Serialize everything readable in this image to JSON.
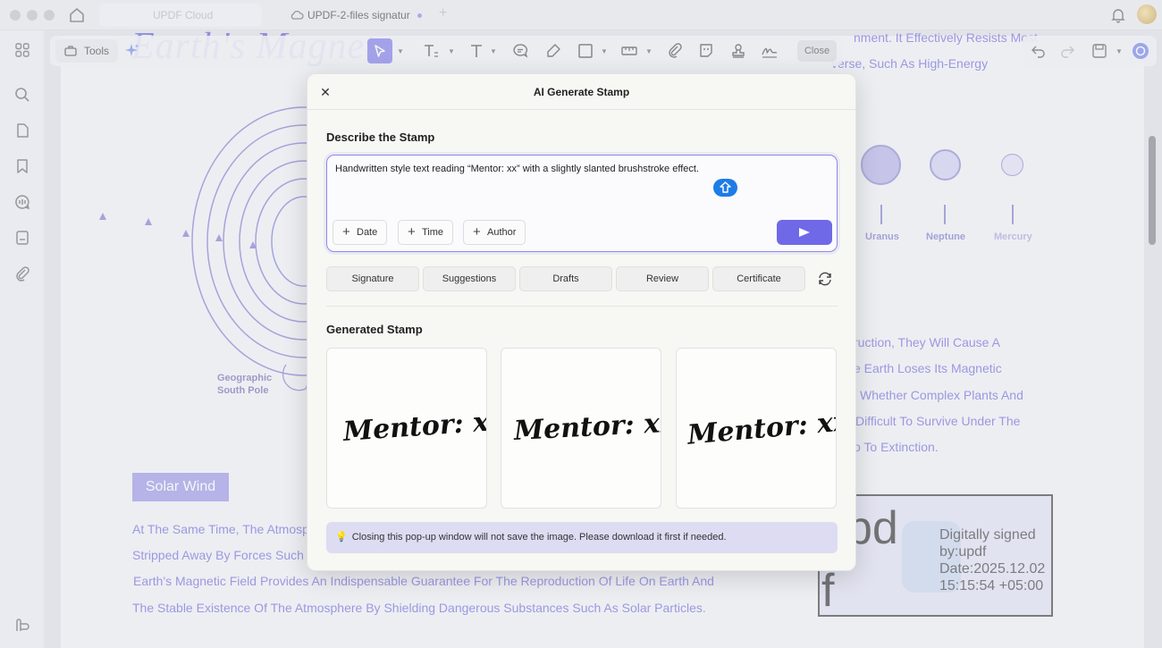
{
  "titlebar": {
    "tabs": [
      {
        "label": "UPDF Cloud"
      },
      {
        "label": "UPDF-2-files signatur"
      }
    ],
    "new_tab_symbol": "+"
  },
  "toolbar": {
    "tools_label": "Tools",
    "close_label": "Close"
  },
  "document": {
    "title": "Earth's Magnet",
    "top_lines": [
      "nment. It Effectively Resists Most",
      "verse, Such As High-Energy"
    ],
    "geo_label_line1": "Geographic",
    "geo_label_line2": "South Pole",
    "planets": [
      {
        "name": "Uranus"
      },
      {
        "name": "Neptune"
      },
      {
        "name": "Mercury"
      }
    ],
    "right_lines": [
      "ruction, They Will Cause A",
      "e Earth Loses Its Magnetic",
      "Whether Complex Plants And",
      "Difficult To Survive Under The",
      "o To Extinction."
    ],
    "solar_wind_label": "Solar Wind",
    "bottom_lines": [
      "At The Same Time, The Atmosp",
      "Stripped Away By Forces Such A",
      "Earth's Magnetic Field Provides An Indispensable Guarantee For The Reproduction Of Life On Earth And",
      "The Stable Existence Of The Atmosphere By Shielding Dangerous Substances Such As Solar Particles."
    ],
    "certificate": {
      "big_text_1": "pd",
      "big_text_2": "f",
      "line1": "Digitally signed",
      "line2": "by:updf",
      "line3": "Date:2025.12.02",
      "line4": "15:15:54 +05:00"
    }
  },
  "dialog": {
    "title": "AI Generate Stamp",
    "describe_label": "Describe the Stamp",
    "prompt_text": "Handwritten style text reading “Mentor: xx” with a slightly slanted brushstroke effect.",
    "chips": [
      {
        "label": "Date"
      },
      {
        "label": "Time"
      },
      {
        "label": "Author"
      }
    ],
    "categories": [
      {
        "label": "Signature"
      },
      {
        "label": "Suggestions"
      },
      {
        "label": "Drafts"
      },
      {
        "label": "Review"
      },
      {
        "label": "Certificate"
      }
    ],
    "generated_label": "Generated Stamp",
    "stamps": [
      {
        "text": "Mentor: xx"
      },
      {
        "text": "Mentor: xx"
      },
      {
        "text": "Mentor: xx"
      }
    ],
    "notice": "Closing this pop-up window will not save the image. Please download it first if needed."
  },
  "colors": {
    "accent": "#6f69e8",
    "doc_text": "#5a55d4",
    "info_blue": "#1e7ce6"
  }
}
